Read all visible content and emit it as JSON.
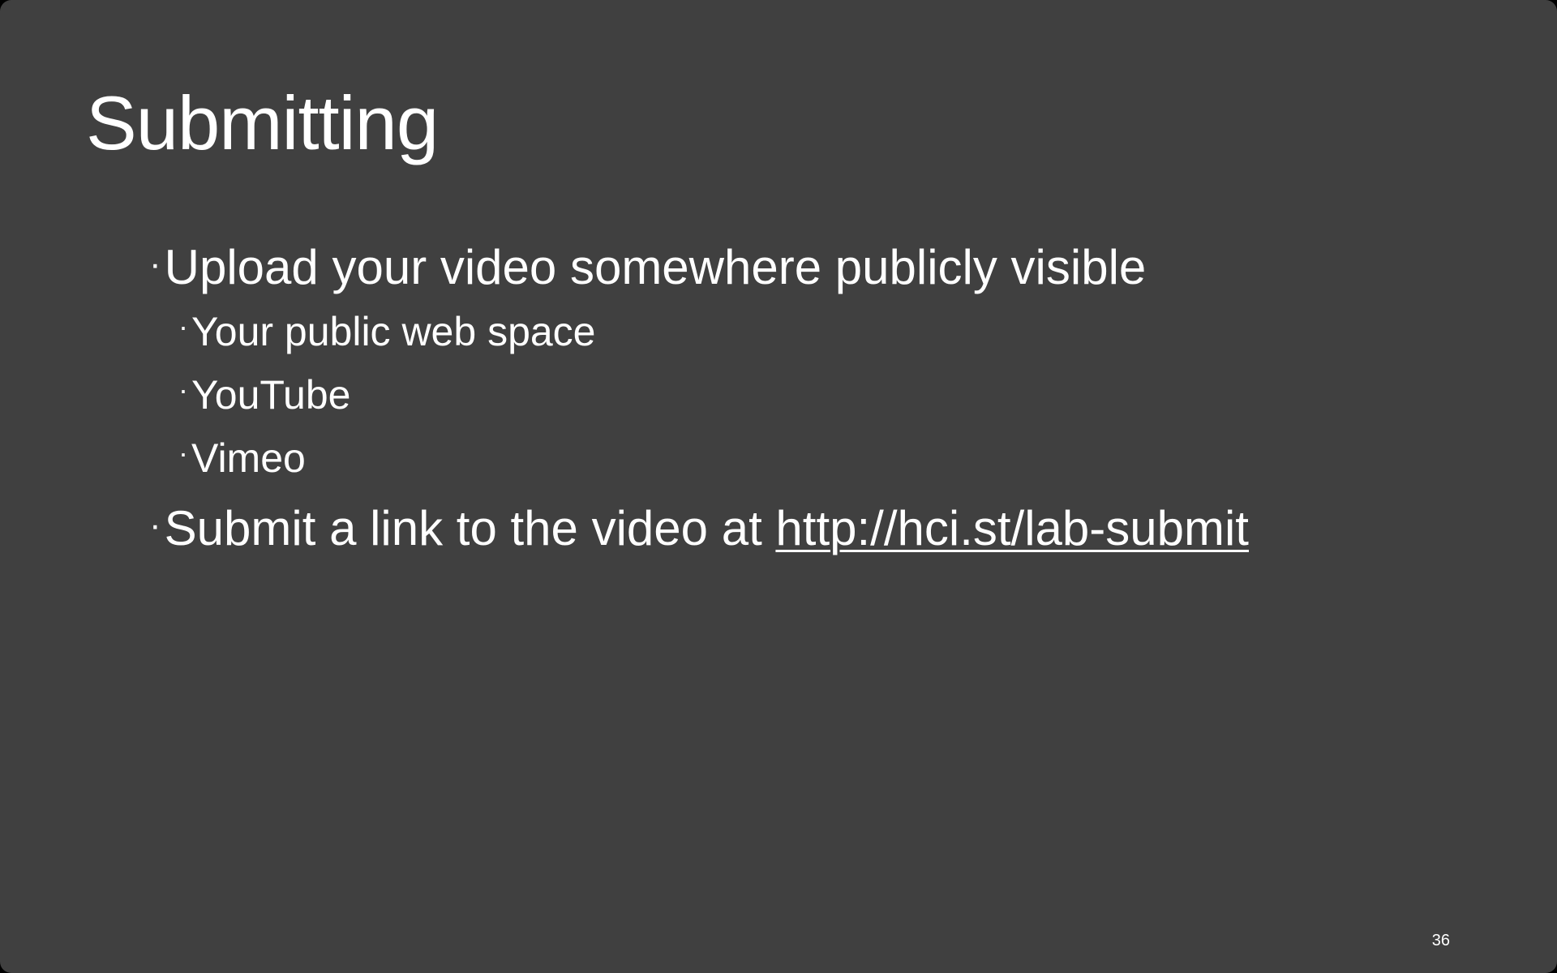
{
  "slide": {
    "title": "Submitting",
    "background_color": "#404040",
    "text_color": "#ffffff",
    "bullet_glyph": "·",
    "bullets": [
      {
        "text": "Upload your video somewhere publicly visible"
      },
      {
        "text": "Your public web space"
      },
      {
        "text": "YouTube"
      },
      {
        "text": "Vimeo"
      },
      {
        "text": "Submit a link to the video at ",
        "link_text": "http://hci.st/lab-submit"
      }
    ],
    "page_number": "36"
  }
}
